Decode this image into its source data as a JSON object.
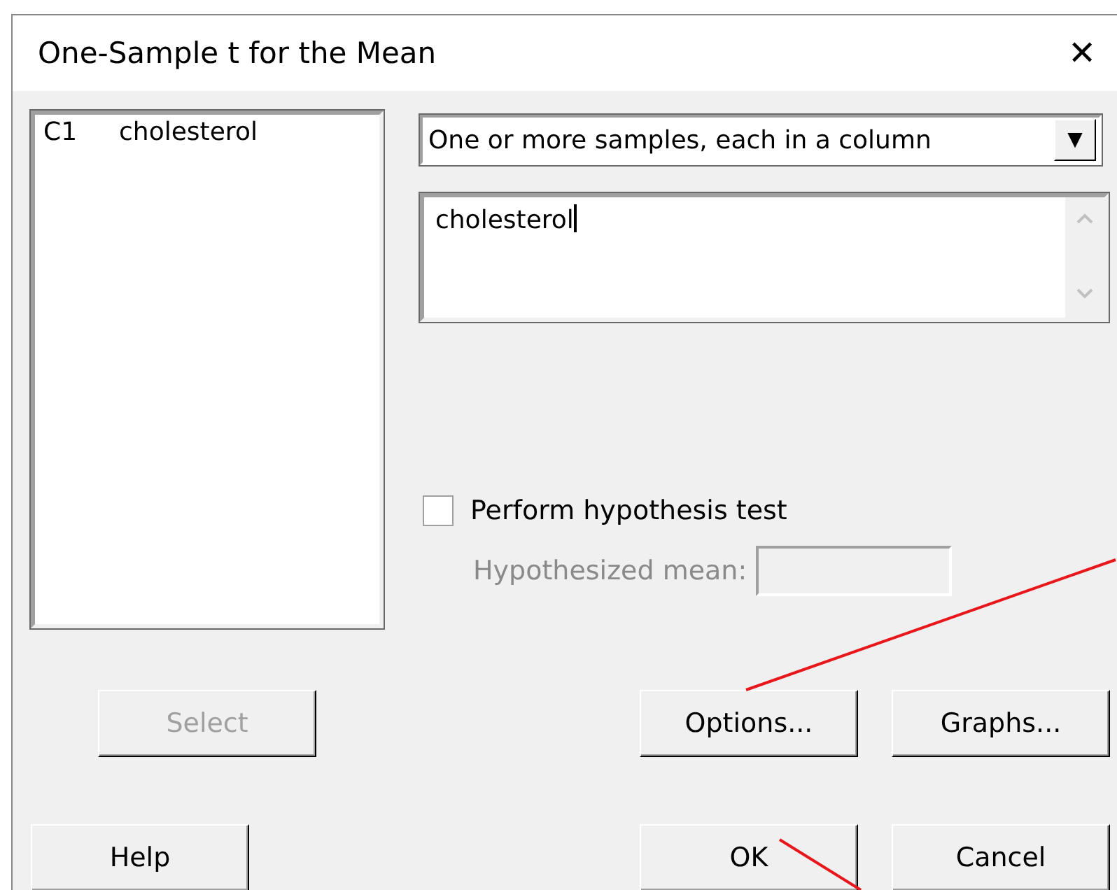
{
  "window": {
    "title": "One-Sample t for the Mean",
    "close": "✕"
  },
  "variables": [
    {
      "column": "C1",
      "name": "cholesterol",
      "selected": false
    }
  ],
  "data_layout": {
    "value": "One or more samples, each in a column",
    "arrow": "▼"
  },
  "samples_field": {
    "value": "cholesterol"
  },
  "hypothesis_test": {
    "label": "Perform hypothesis test",
    "checked": false
  },
  "hypothesized_mean": {
    "label": "Hypothesized mean:",
    "disabled": true
  },
  "buttons": [
    {
      "label": "Select",
      "disabled": true
    },
    {
      "label": "Options...",
      "disabled": false
    },
    {
      "label": "Graphs...",
      "disabled": false
    },
    {
      "label": "Help",
      "disabled": false
    },
    {
      "label": "OK",
      "disabled": false
    },
    {
      "label": "Cancel",
      "disabled": false
    }
  ],
  "pointer_lines": {
    "options": true,
    "ok": true
  }
}
